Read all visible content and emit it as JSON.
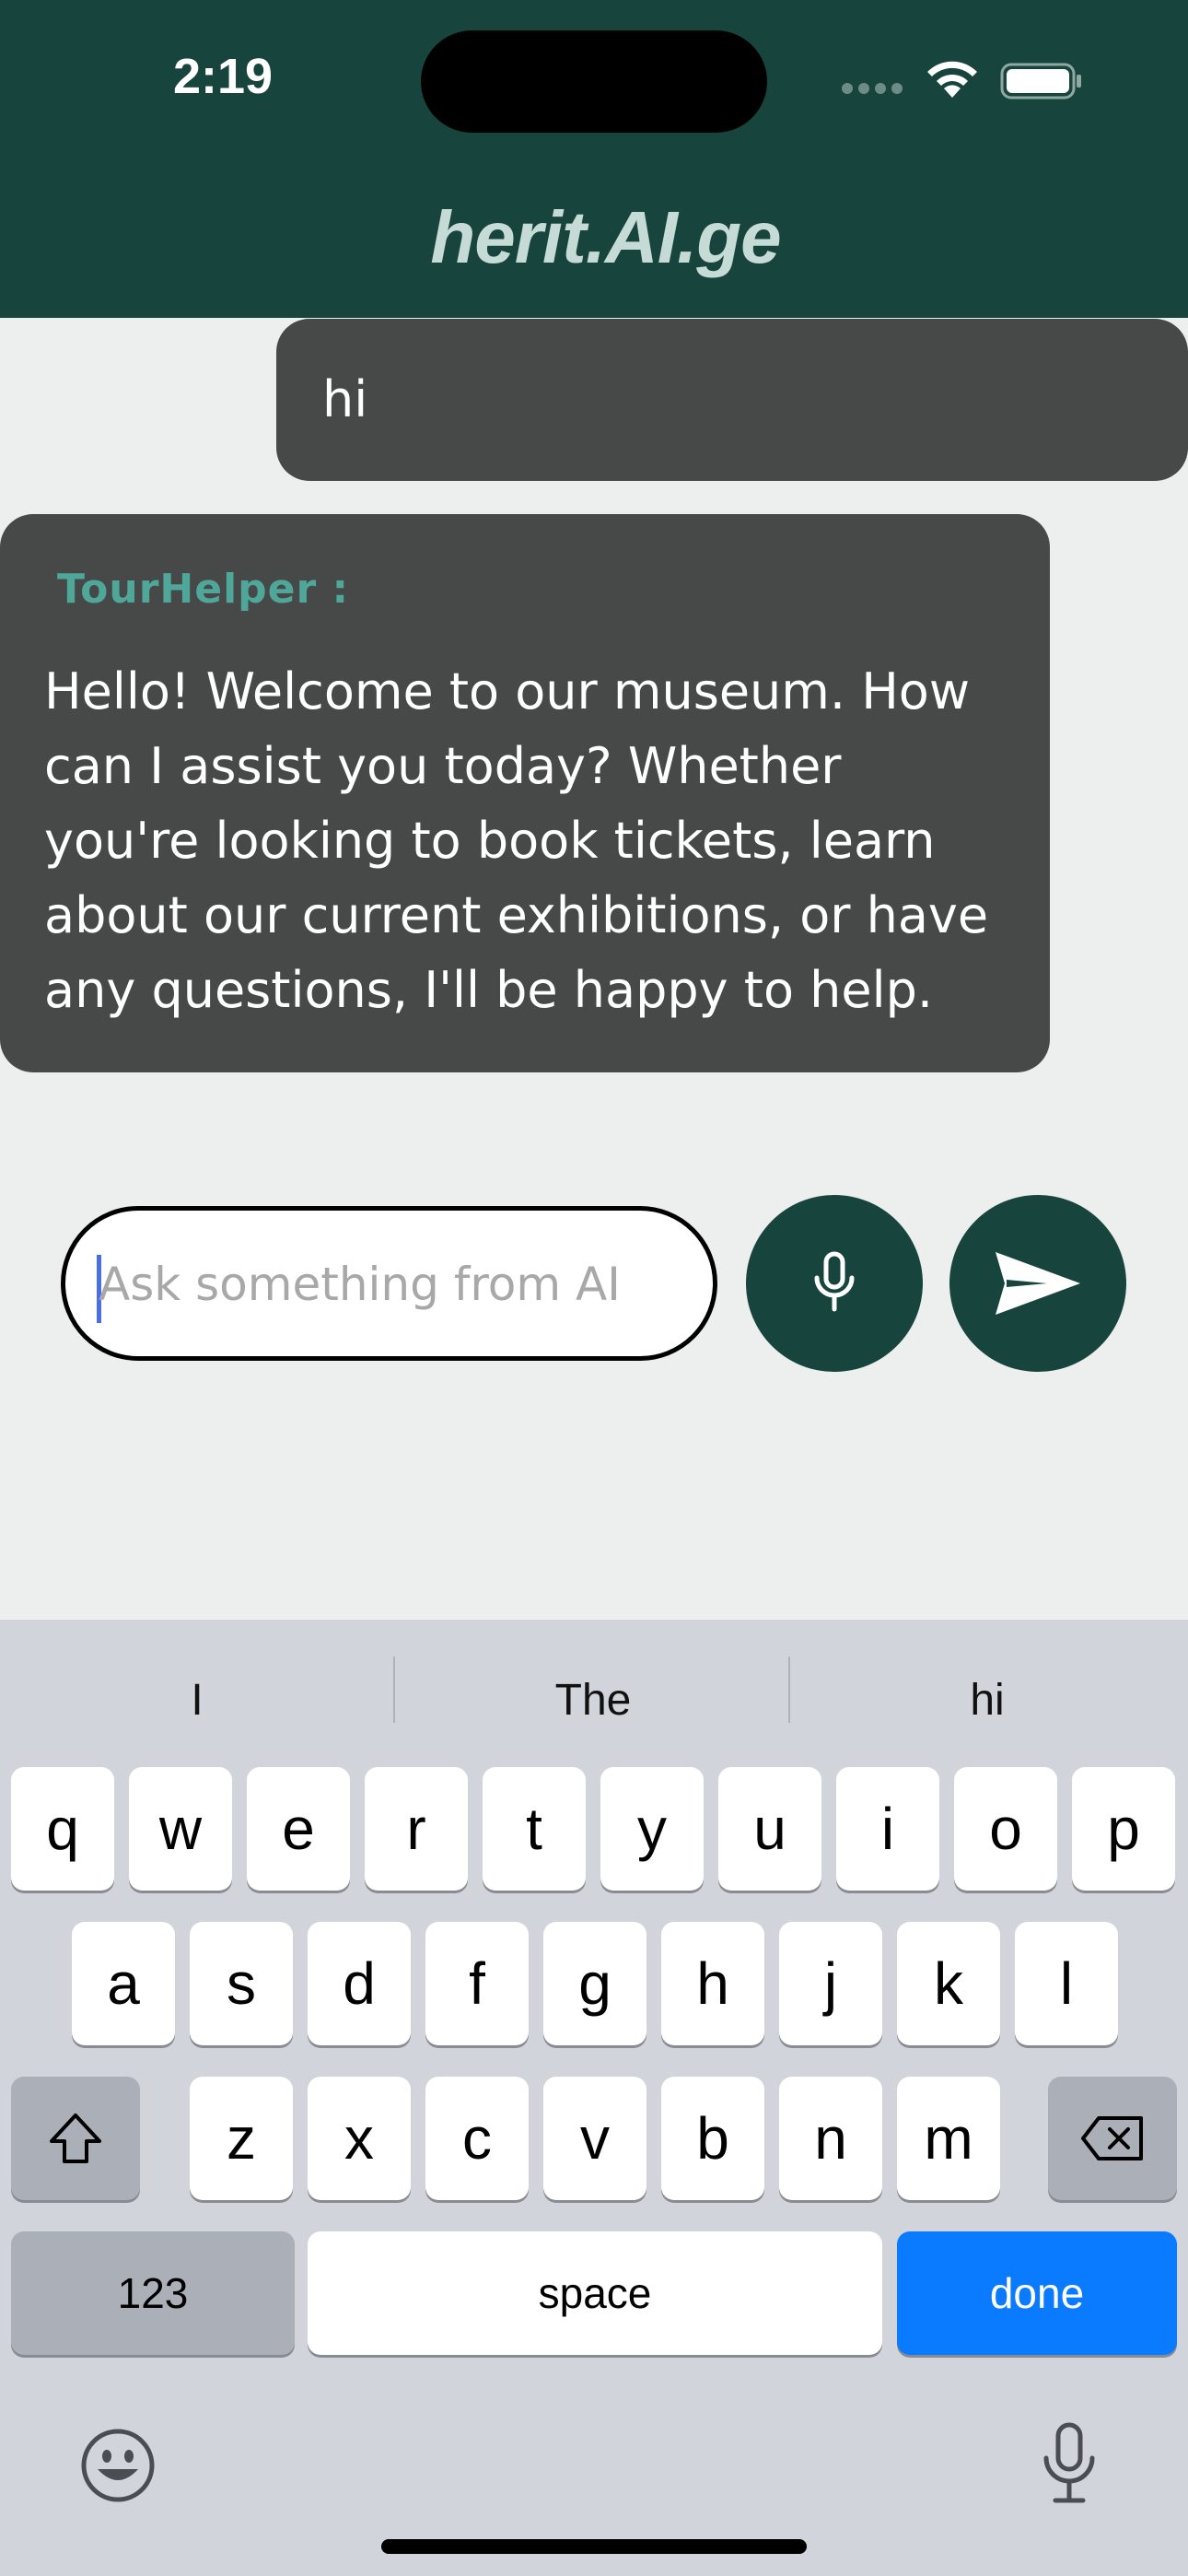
{
  "status_bar": {
    "time": "2:19"
  },
  "header": {
    "title": "herit.AI.ge"
  },
  "chat": {
    "user_message": "hi",
    "bot_sender": "TourHelper :",
    "bot_message_lines": [
      "Hello! Welcome to our museum. How",
      "can I assist you today? Whether",
      "you're looking to book tickets, learn",
      "about our current exhibitions, or have",
      "any questions, I'll be happy to help."
    ]
  },
  "composer": {
    "placeholder": "Ask something from AI",
    "value": "",
    "mic_icon": "microphone-icon",
    "send_icon": "send-icon"
  },
  "keyboard": {
    "suggestions": [
      "I",
      "The",
      "hi"
    ],
    "row1": [
      "q",
      "w",
      "e",
      "r",
      "t",
      "y",
      "u",
      "i",
      "o",
      "p"
    ],
    "row2": [
      "a",
      "s",
      "d",
      "f",
      "g",
      "h",
      "j",
      "k",
      "l"
    ],
    "row3": [
      "z",
      "x",
      "c",
      "v",
      "b",
      "n",
      "m"
    ],
    "numbers_label": "123",
    "space_label": "space",
    "done_label": "done",
    "done_color": "#0A7AFF"
  },
  "colors": {
    "header_bg": "#17453E",
    "bubble_bg": "#474848",
    "sender_color": "#4FA79A",
    "title_color": "#C6DBD5"
  }
}
